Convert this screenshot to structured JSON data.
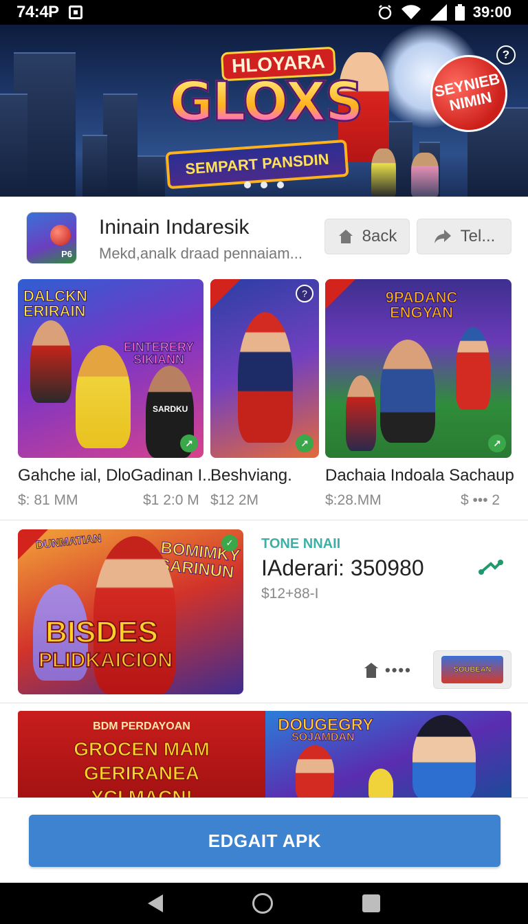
{
  "status_bar": {
    "time": "74:4P",
    "battery": "39:00"
  },
  "hero": {
    "logo_top": "HLOYARA",
    "logo_main": "GLOXS",
    "logo_ribbon": "SEMPART PANSDIN",
    "badge_line1": "SEYNIEB",
    "badge_line2": "NIMIN",
    "info_icon": "info-icon",
    "carousel_dots": 3
  },
  "app": {
    "icon_tag": "P6",
    "title": "Ininain Indaresik",
    "subtitle": "Mekd,analk draad pennaiam...",
    "back_label": "8ack",
    "share_label": "Tel..."
  },
  "cards": [
    {
      "banner": "DALCKN ERIRAIN",
      "banner2": "EINTERERY SIKIANN",
      "label": "Gahche ial, DloGadinan I..",
      "price": "$: 81 MM",
      "price2": "$1 2:0 M"
    },
    {
      "banner": "",
      "label": "Beshviang.",
      "price": "$12 2M"
    },
    {
      "banner": "9PADANC ENGYAN",
      "label": "Dachaia Indoala Sachaup",
      "price": "$:28.MM",
      "price2": "$ ••• 2"
    }
  ],
  "card_jersey": "SARDKU",
  "feature": {
    "image_text_top": "DUNMATIAN",
    "image_text_right": "BOMIMKY SARINUN",
    "image_text_main": "BISDES",
    "image_text_sub": "PLIDKAICION",
    "tag": "TONE NNAII",
    "title": "IAderari: 350980",
    "price": "$12+88-I",
    "more_label": "••••",
    "thumb_text": "SOUBEAN"
  },
  "promo": {
    "left_small": "BDM PERDAYOAN",
    "left_big_line1": "GROCEN MAM GERIRANEA",
    "left_big_line2": "YCI MACN!",
    "right_title_line1": "DOUGEGRY",
    "right_title_line2": "SOJAMDAN"
  },
  "cta": {
    "label": "EDGAIT APK"
  },
  "colors": {
    "accent": "#3d83d0",
    "tag": "#3cb0a6",
    "share": "#1f9a6a"
  }
}
